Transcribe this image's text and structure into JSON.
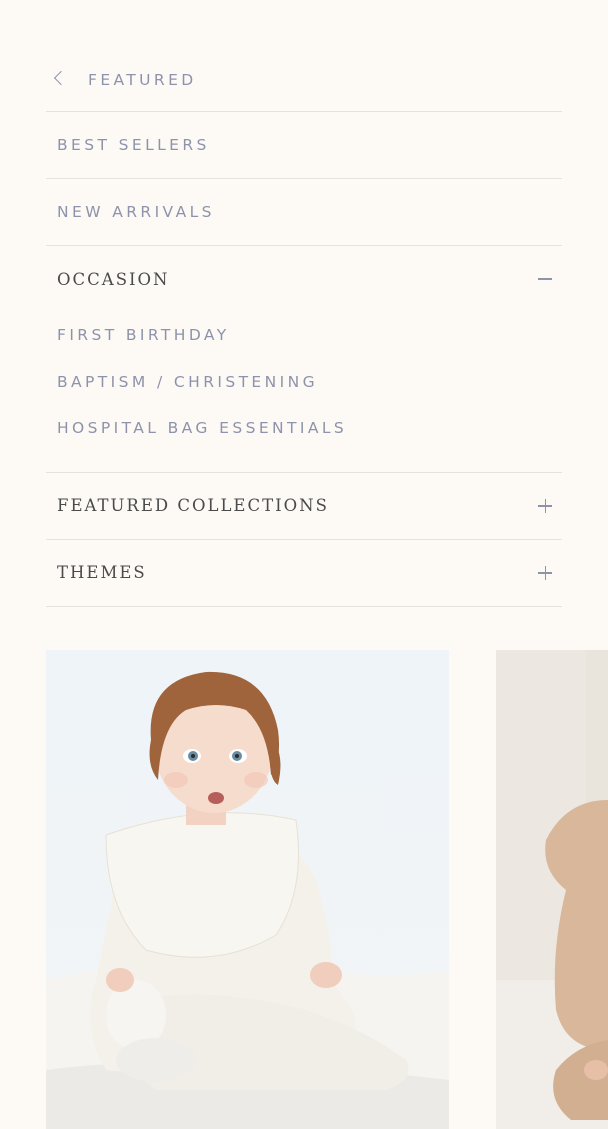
{
  "menu": {
    "back_label": "FEATURED",
    "links": [
      "BEST SELLERS",
      "NEW ARRIVALS"
    ],
    "occasion": {
      "label": "OCCASION",
      "items": [
        "FIRST BIRTHDAY",
        "BAPTISM / CHRISTENING",
        "HOSPITAL BAG ESSENTIALS"
      ]
    },
    "featured_collections_label": "FEATURED COLLECTIONS",
    "themes_label": "THEMES"
  },
  "cards": [
    {
      "name": "baby-in-white-bib-photo"
    },
    {
      "name": "baby-in-beige-outfit-photo"
    }
  ],
  "colors": {
    "background": "#fdfaf6",
    "link_text": "#8e93ab",
    "heading_text": "#4a4a4a",
    "divider": "#e6e2dc"
  }
}
